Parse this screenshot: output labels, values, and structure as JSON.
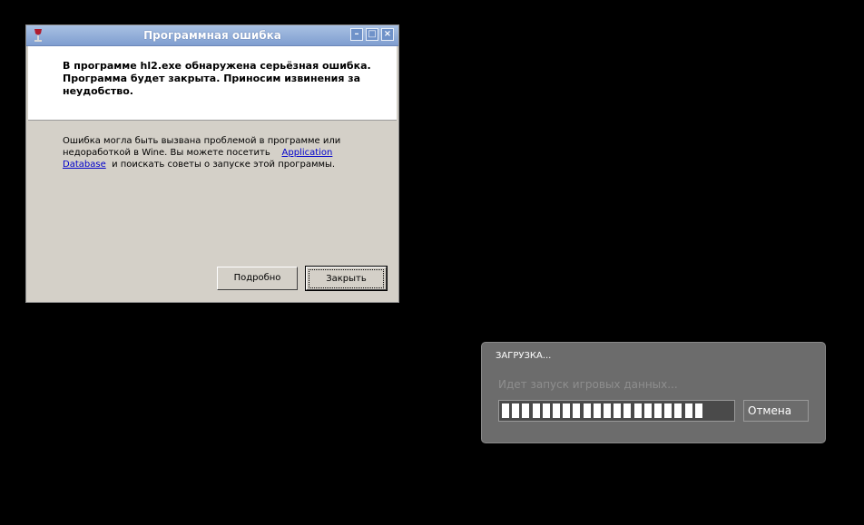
{
  "dialog": {
    "title": "Программная ошибка",
    "header_line1": "В программе hl2.exe обнаружена серьёзная ошибка.",
    "header_line2": "Программа будет закрыта. Приносим извинения за",
    "header_line3": "неудобство.",
    "body_line1": "Ошибка могла быть вызвана проблемой в программе или",
    "body_line2_pre": "недоработкой в Wine. Вы можете посетить",
    "link_part1": "Application",
    "link_part2": "Database",
    "body_line3_post": "и поискать советы о запуске этой программы.",
    "details_button": "Подробно",
    "close_button": "Закрыть",
    "window_controls": {
      "minimize": "–",
      "maximize": "□",
      "close": "×"
    },
    "icons": {
      "app": "wine-glass-icon"
    }
  },
  "loader": {
    "title": "ЗАГРУЗКА...",
    "status": "Идет запуск игровых данных...",
    "progress_fraction": 0.89,
    "cancel_button": "Отмена"
  },
  "colors": {
    "titlebar": "#7f9ed0",
    "dialog_bg": "#d4d0c8",
    "link": "#0000cc",
    "loader_bg": "#6c6c6c"
  }
}
